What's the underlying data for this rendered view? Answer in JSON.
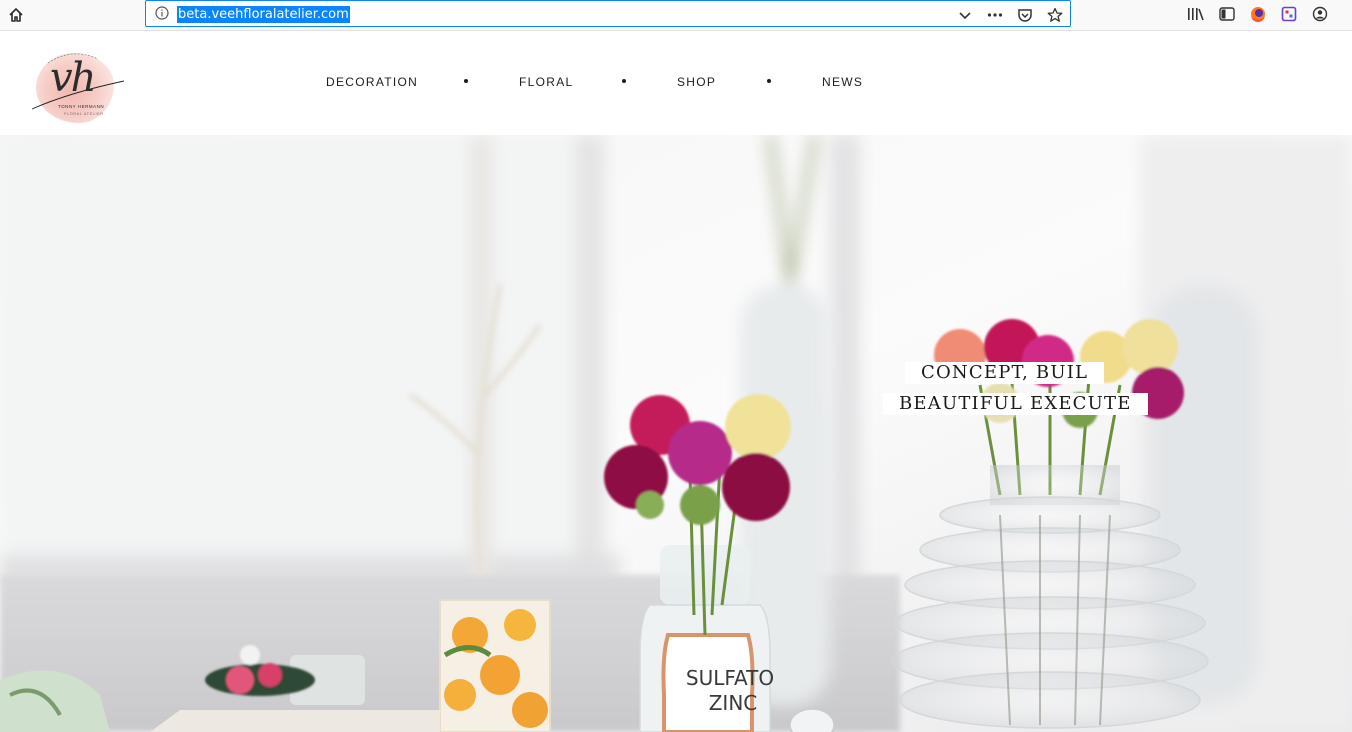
{
  "browser": {
    "url": "beta.veehfloralatelier.com",
    "icons": [
      "home-icon",
      "info-icon",
      "chevron-down-icon",
      "more-icon",
      "pocket-icon",
      "star-icon",
      "library-icon",
      "sidebar-icon",
      "firefox-icon",
      "extension-icon",
      "account-icon"
    ]
  },
  "site": {
    "logo": {
      "mark": "vh",
      "name": "TONNY HERMANN",
      "sub": "FLORAL ATELIER"
    },
    "nav": [
      {
        "label": "DECORATION"
      },
      {
        "label": "FLORAL"
      },
      {
        "label": "SHOP"
      },
      {
        "label": "NEWS"
      }
    ]
  },
  "hero": {
    "caption_line_1": "CONCEPT, BUIL",
    "caption_line_2": "BEAUTIFUL EXECUTE",
    "bottle_label_1": "SULFATO",
    "bottle_label_2": "ZINC"
  },
  "colors": {
    "accent": "#0a84ff",
    "nav_text": "#1d1d1d",
    "flower_magenta": "#a0125a",
    "flower_yellow": "#f1e29a",
    "flower_coral": "#f0907a"
  }
}
